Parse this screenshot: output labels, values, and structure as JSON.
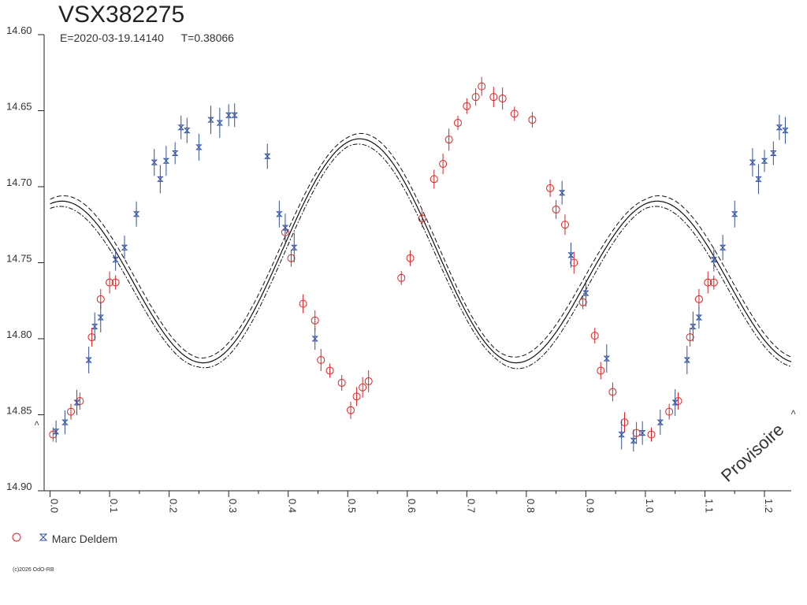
{
  "chart_data": {
    "type": "scatter",
    "title": "VSX382275",
    "epoch_label": "E=2020-03-19.14140",
    "period_label": "T=0.38066",
    "xlabel": "",
    "ylabel": "",
    "xlim": [
      -0.01,
      1.245
    ],
    "ylim": [
      14.9,
      14.6
    ],
    "y_inverted": true,
    "x_ticks": [
      "0.0",
      "0.1",
      "0.2",
      "0.3",
      "0.4",
      "0.5",
      "0.6",
      "0.7",
      "0.8",
      "0.9",
      "1.0",
      "1.1",
      "1.2"
    ],
    "y_ticks": [
      "14.60",
      "14.65",
      "14.70",
      "14.75",
      "14.80",
      "14.85",
      "14.90"
    ],
    "grid": false,
    "legend_position": "bottom-left",
    "watermark": "Provisoire",
    "copyright": "(c)2026 OdO-RB",
    "colors": {
      "red_series": "#dd2222",
      "blue_series": "#3050a0",
      "axis": "#222222",
      "fit": "#111111"
    },
    "series": [
      {
        "marker": "circle",
        "color": "#dd2222",
        "points": [
          [
            0.005,
            14.863
          ],
          [
            0.035,
            14.848
          ],
          [
            0.05,
            14.841
          ],
          [
            0.07,
            14.799
          ],
          [
            0.085,
            14.774
          ],
          [
            0.1,
            14.763
          ],
          [
            0.11,
            14.763
          ],
          [
            0.395,
            14.73
          ],
          [
            0.405,
            14.747
          ],
          [
            0.425,
            14.777
          ],
          [
            0.445,
            14.788
          ],
          [
            0.455,
            14.814
          ],
          [
            0.47,
            14.821
          ],
          [
            0.49,
            14.829
          ],
          [
            0.505,
            14.847
          ],
          [
            0.515,
            14.838
          ],
          [
            0.525,
            14.832
          ],
          [
            0.535,
            14.828
          ],
          [
            0.59,
            14.76
          ],
          [
            0.605,
            14.747
          ],
          [
            0.625,
            14.721
          ],
          [
            0.645,
            14.695
          ],
          [
            0.66,
            14.685
          ],
          [
            0.67,
            14.669
          ],
          [
            0.685,
            14.658
          ],
          [
            0.7,
            14.647
          ],
          [
            0.715,
            14.641
          ],
          [
            0.725,
            14.634
          ],
          [
            0.745,
            14.641
          ],
          [
            0.76,
            14.642
          ],
          [
            0.78,
            14.652
          ],
          [
            0.81,
            14.656
          ],
          [
            0.84,
            14.701
          ],
          [
            0.85,
            14.715
          ],
          [
            0.865,
            14.725
          ],
          [
            0.88,
            14.75
          ],
          [
            0.895,
            14.776
          ],
          [
            0.915,
            14.798
          ],
          [
            0.925,
            14.821
          ],
          [
            0.945,
            14.835
          ],
          [
            0.965,
            14.855
          ],
          [
            0.985,
            14.862
          ],
          [
            1.01,
            14.863
          ],
          [
            1.04,
            14.848
          ],
          [
            1.055,
            14.841
          ],
          [
            1.075,
            14.799
          ],
          [
            1.09,
            14.774
          ],
          [
            1.105,
            14.763
          ],
          [
            1.115,
            14.763
          ]
        ]
      },
      {
        "name": "Marc Deldem",
        "marker": "bowtie",
        "color": "#3050a0",
        "points": [
          [
            0.01,
            14.861
          ],
          [
            0.025,
            14.855
          ],
          [
            0.045,
            14.842
          ],
          [
            0.065,
            14.814
          ],
          [
            0.075,
            14.792
          ],
          [
            0.085,
            14.786
          ],
          [
            0.11,
            14.748
          ],
          [
            0.125,
            14.74
          ],
          [
            0.145,
            14.718
          ],
          [
            0.175,
            14.684
          ],
          [
            0.185,
            14.695
          ],
          [
            0.195,
            14.683
          ],
          [
            0.21,
            14.678
          ],
          [
            0.22,
            14.661
          ],
          [
            0.23,
            14.663
          ],
          [
            0.25,
            14.674
          ],
          [
            0.27,
            14.656
          ],
          [
            0.285,
            14.658
          ],
          [
            0.3,
            14.653
          ],
          [
            0.31,
            14.653
          ],
          [
            0.365,
            14.68
          ],
          [
            0.385,
            14.718
          ],
          [
            0.395,
            14.727
          ],
          [
            0.41,
            14.74
          ],
          [
            0.445,
            14.8
          ],
          [
            0.86,
            14.704
          ],
          [
            0.875,
            14.745
          ],
          [
            0.9,
            14.77
          ],
          [
            0.935,
            14.813
          ],
          [
            0.96,
            14.863
          ],
          [
            0.98,
            14.867
          ],
          [
            0.995,
            14.862
          ],
          [
            1.025,
            14.855
          ],
          [
            1.05,
            14.842
          ],
          [
            1.07,
            14.814
          ],
          [
            1.08,
            14.792
          ],
          [
            1.09,
            14.786
          ],
          [
            1.115,
            14.748
          ],
          [
            1.13,
            14.74
          ],
          [
            1.15,
            14.718
          ],
          [
            1.18,
            14.684
          ],
          [
            1.19,
            14.695
          ],
          [
            1.2,
            14.683
          ],
          [
            1.215,
            14.678
          ],
          [
            1.225,
            14.661
          ],
          [
            1.235,
            14.663
          ]
        ]
      }
    ]
  }
}
